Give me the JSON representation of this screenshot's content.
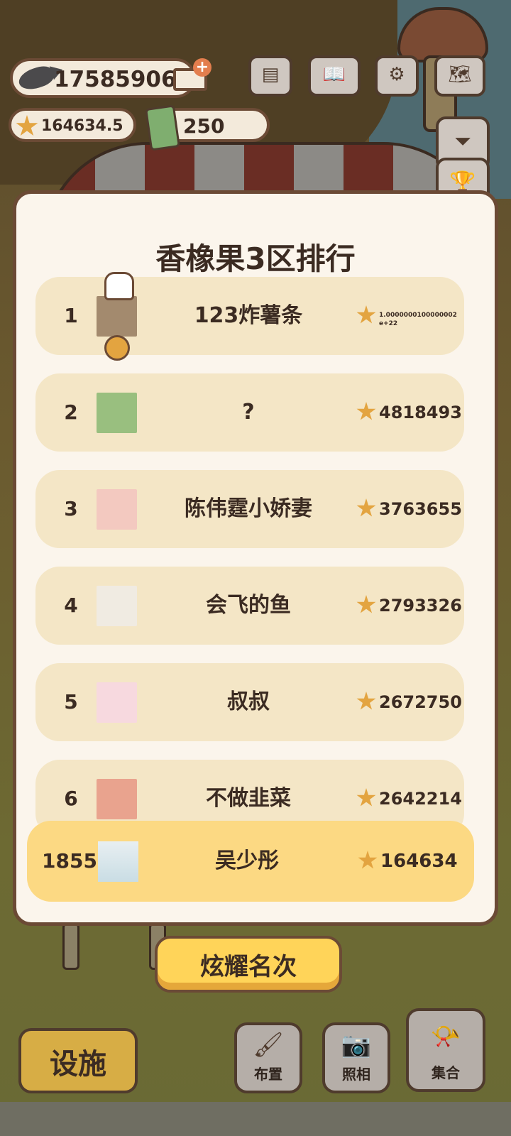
{
  "hud": {
    "fish_count": "17585906",
    "star_count": "164634.5",
    "ticket_count": "250",
    "buttons": [
      {
        "icon": "newspaper-icon",
        "glyph": "▤"
      },
      {
        "icon": "book-icon",
        "glyph": "📖"
      },
      {
        "icon": "gear-icon",
        "glyph": "⚙"
      },
      {
        "icon": "map-icon",
        "glyph": "🗺"
      }
    ],
    "side_buttons": [
      {
        "icon": "collapse-icon",
        "glyph": "⏷"
      },
      {
        "icon": "podium-icon",
        "glyph": "🏆"
      }
    ],
    "add_symbol": "+"
  },
  "ranking": {
    "title": "香橡果3区排行",
    "rows": [
      {
        "rank": "1",
        "name": "123炸薯条",
        "score": "1.0000000100000002e+22",
        "avatar_color": "#a38a6e"
      },
      {
        "rank": "2",
        "name": "?",
        "score": "4818493",
        "avatar_color": "#99bf7f"
      },
      {
        "rank": "3",
        "name": "陈伟霆小娇妻",
        "score": "3763655",
        "avatar_color": "#f3c9c0"
      },
      {
        "rank": "4",
        "name": "会飞的鱼",
        "score": "2793326",
        "avatar_color": "#f0ebe2"
      },
      {
        "rank": "5",
        "name": "叔叔",
        "score": "2672750",
        "avatar_color": "#f7d9df"
      },
      {
        "rank": "6",
        "name": "不做韭菜",
        "score": "2642214",
        "avatar_color": "#e9a38e"
      }
    ],
    "self": {
      "rank": "1855",
      "name": "吴少彤",
      "score": "164634"
    }
  },
  "show_button_label": "炫耀名次",
  "bottom": {
    "facility_label": "设施",
    "tools": [
      {
        "label": "布置",
        "icon": "paint-roller-icon",
        "glyph": "🖌"
      },
      {
        "label": "照相",
        "icon": "camera-icon",
        "glyph": "📷"
      },
      {
        "label": "集合",
        "icon": "whistle-icon",
        "glyph": "📯"
      }
    ]
  },
  "colors": {
    "accent": "#ffd459",
    "row_bg": "#f4e6c6",
    "self_row_bg": "#fcd983",
    "border": "#6b4a35"
  }
}
